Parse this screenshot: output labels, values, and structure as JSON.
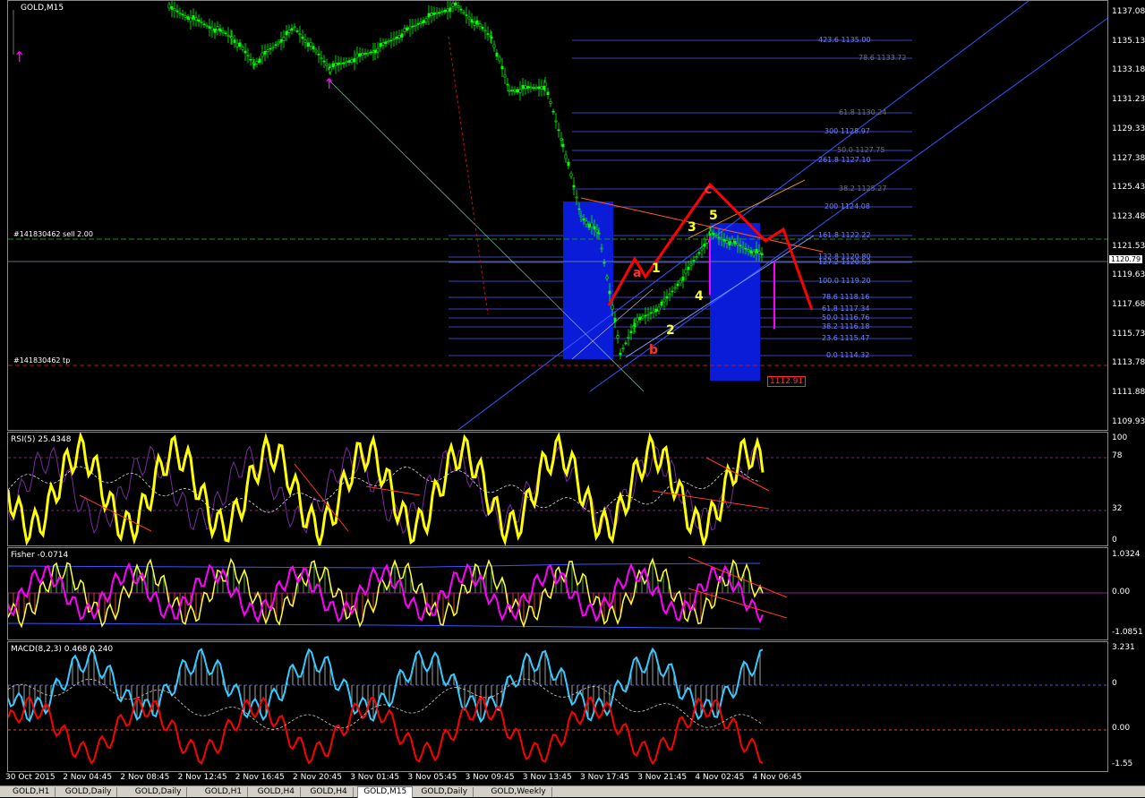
{
  "chart": {
    "symbol_label": "GOLD,M15",
    "current_price": "1120.79",
    "tp_box": "1112.91",
    "order_sell": "#141830462 sell 2.00",
    "order_tp": "#141830462 tp",
    "price_axis": [
      "1137.08",
      "1135.13",
      "1133.18",
      "1131.23",
      "1129.33",
      "1127.38",
      "1125.43",
      "1123.48",
      "1121.53",
      "1119.63",
      "1117.68",
      "1115.73",
      "1113.78",
      "1111.88",
      "1109.93"
    ],
    "fib_labels": [
      {
        "text": "423.6 1135.00",
        "style": "blue"
      },
      {
        "text": "78.6 1133.72",
        "style": "gray"
      },
      {
        "text": "61.8 1130.24",
        "style": "gray"
      },
      {
        "text": "300 1128.97",
        "style": "blue"
      },
      {
        "text": "50.0 1127.75",
        "style": "gray"
      },
      {
        "text": "261.8 1127.10",
        "style": "blue"
      },
      {
        "text": "38.2 1125.27",
        "style": "gray"
      },
      {
        "text": "200 1124.08",
        "style": "blue"
      },
      {
        "text": "161.8 1122.22",
        "style": "blue"
      },
      {
        "text": "132.8 1120.80",
        "style": "blue"
      },
      {
        "text": "127.2 1120.53",
        "style": "blue"
      },
      {
        "text": "100.0 1119.20",
        "style": "blue"
      },
      {
        "text": "78.6 1118.16",
        "style": "blue"
      },
      {
        "text": "61.8 1117.34",
        "style": "blue"
      },
      {
        "text": "50.0 1116.76",
        "style": "blue"
      },
      {
        "text": "38.2 1116.18",
        "style": "blue"
      },
      {
        "text": "23.6 1115.47",
        "style": "blue"
      },
      {
        "text": "0.0 1114.32",
        "style": "blue"
      }
    ],
    "waves": {
      "a": "a",
      "b": "b",
      "c": "c",
      "w1": "1",
      "w2": "2",
      "w3": "3",
      "w4": "4",
      "w5": "5"
    }
  },
  "rsi": {
    "label": "RSI(5) 25.4348",
    "axis": [
      "100",
      "78",
      "32",
      "0"
    ]
  },
  "fisher": {
    "label": "Fisher -0.0714",
    "axis": [
      "1.0324",
      "0.00",
      "-1.0851"
    ]
  },
  "macd": {
    "label": "MACD(8,2,3) 0.468 0.240",
    "axis": [
      "3.231",
      "0",
      "0.00",
      "-1.55"
    ]
  },
  "time_axis": [
    "30 Oct 2015",
    "2 Nov 04:45",
    "2 Nov 08:45",
    "2 Nov 12:45",
    "2 Nov 16:45",
    "2 Nov 20:45",
    "3 Nov 01:45",
    "3 Nov 05:45",
    "3 Nov 09:45",
    "3 Nov 13:45",
    "3 Nov 17:45",
    "3 Nov 21:45",
    "4 Nov 02:45",
    "4 Nov 06:45"
  ],
  "tabs": [
    "GOLD,H1",
    "GOLD,Daily",
    "GOLD,Daily",
    "GOLD,H1",
    "GOLD,H4",
    "GOLD,H4",
    "GOLD,M15",
    "GOLD,Daily",
    "GOLD,Weekly"
  ],
  "active_tab": "GOLD,M15",
  "colors": {
    "candle": "#00ff00",
    "rsi": "#ffff00",
    "fisher_signal": "#ff00ff",
    "macd_main": "#33ccff",
    "macd_signal": "#ff0000",
    "projection": "#ff0000",
    "fib": "#4a5cff"
  }
}
